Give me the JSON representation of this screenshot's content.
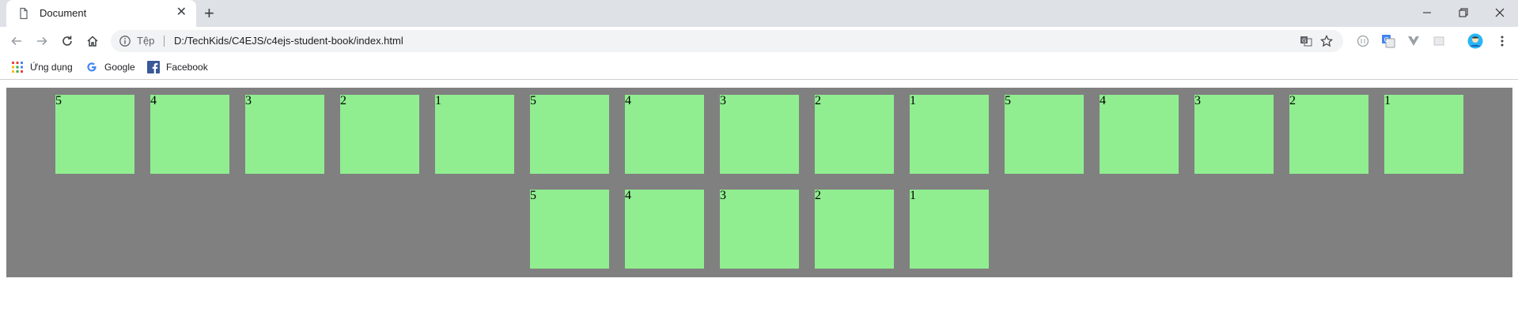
{
  "browser": {
    "tab_title": "Document",
    "address_label": "Tệp",
    "url": "D:/TechKids/C4EJS/c4ejs-student-book/index.html"
  },
  "bookmarks": [
    {
      "label": "Ứng dụng",
      "icon": "apps-grid-icon"
    },
    {
      "label": "Google",
      "icon": "google-icon"
    },
    {
      "label": "Facebook",
      "icon": "facebook-icon"
    }
  ],
  "boxes": {
    "row1": [
      "5",
      "4",
      "3",
      "2",
      "1",
      "5",
      "4",
      "3",
      "2",
      "1",
      "5",
      "4",
      "3",
      "2",
      "1"
    ],
    "row2": [
      "5",
      "4",
      "3",
      "2",
      "1"
    ]
  },
  "colors": {
    "page_background": "#808080",
    "box_fill": "#90ee90"
  }
}
